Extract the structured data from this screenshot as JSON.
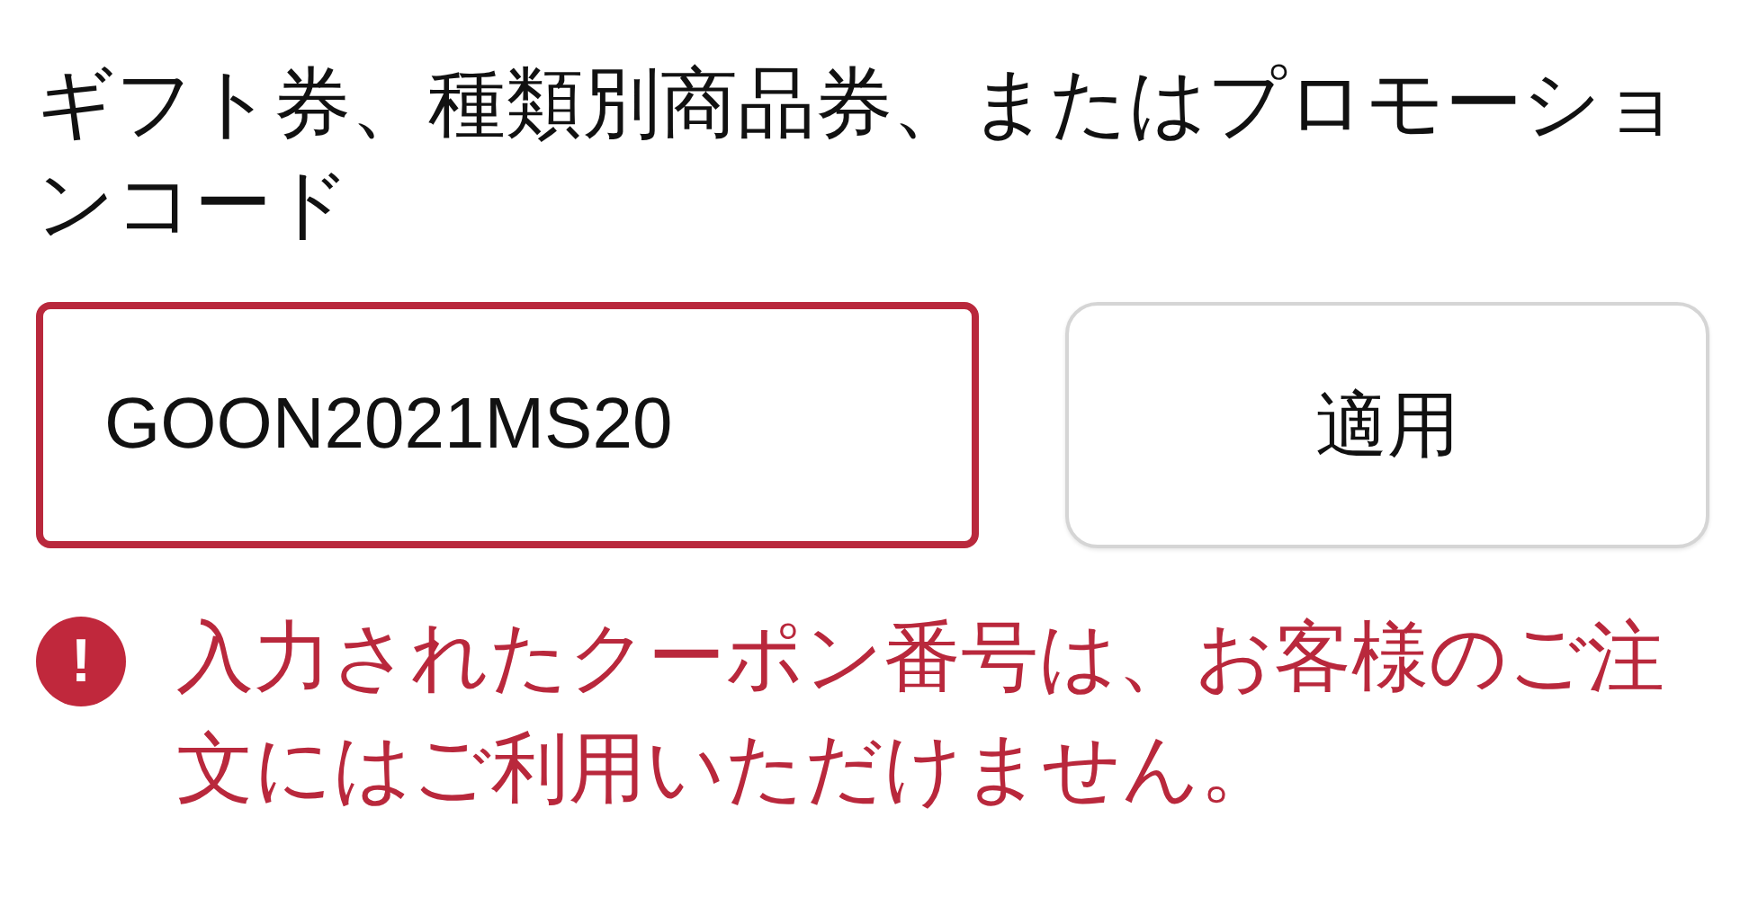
{
  "label": "ギフト券、種類別商品券、またはプロモーションコード",
  "code_field": {
    "value": "GOON2021MS20",
    "invalid": true
  },
  "apply_button": "適用",
  "error": {
    "icon": "!",
    "message": "入力されたクーポン番号は、お客様のご注文にはご利用いただけません。"
  }
}
